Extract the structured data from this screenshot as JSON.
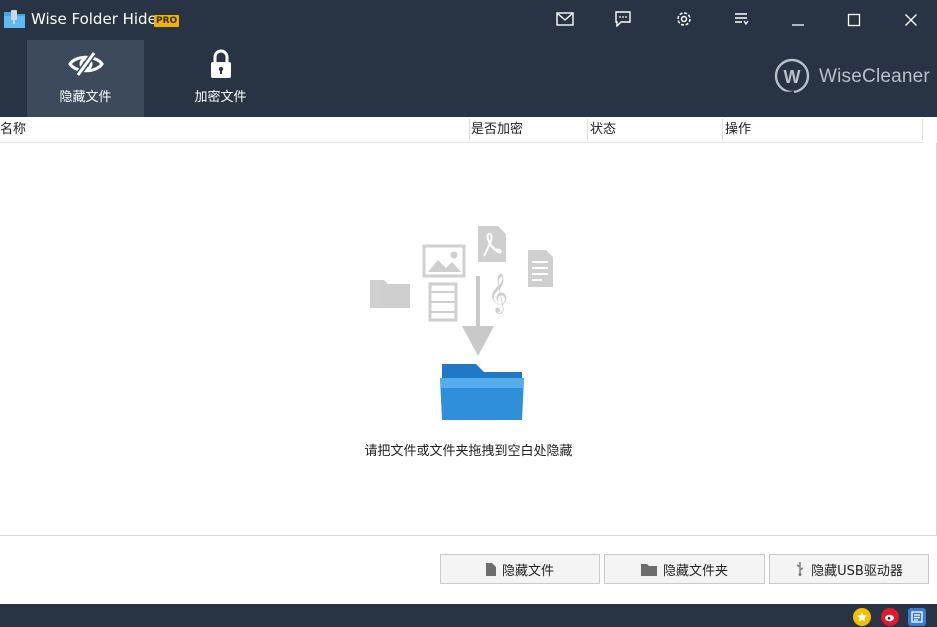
{
  "window": {
    "title": "Wise Folder Hider",
    "badge": "PRO"
  },
  "titlebar_icons": [
    "mail-icon",
    "feedback-icon",
    "settings-icon",
    "menu-icon"
  ],
  "window_controls": [
    "minimize",
    "maximize",
    "close"
  ],
  "nav": {
    "tabs": [
      {
        "label": "隐藏文件",
        "icon": "eye-slash-icon",
        "active": true
      },
      {
        "label": "加密文件",
        "icon": "lock-icon",
        "active": false
      }
    ]
  },
  "brand": {
    "logo_letter": "W",
    "name": "WiseCleaner"
  },
  "table": {
    "columns": [
      "名称",
      "是否加密",
      "状态",
      "操作"
    ]
  },
  "empty_state": {
    "message": "请把文件或文件夹拖拽到空白处隐藏"
  },
  "actions": {
    "hide_file": "隐藏文件",
    "hide_folder": "隐藏文件夹",
    "hide_usb": "隐藏USB驱动器"
  },
  "statusbar_icons": [
    "rate-icon",
    "weibo-icon",
    "news-icon"
  ],
  "colors": {
    "chrome": "#283444",
    "active_tab": "#3d4a5c",
    "badge": "#f2b200",
    "folder_blue": "#2f8fd8"
  }
}
